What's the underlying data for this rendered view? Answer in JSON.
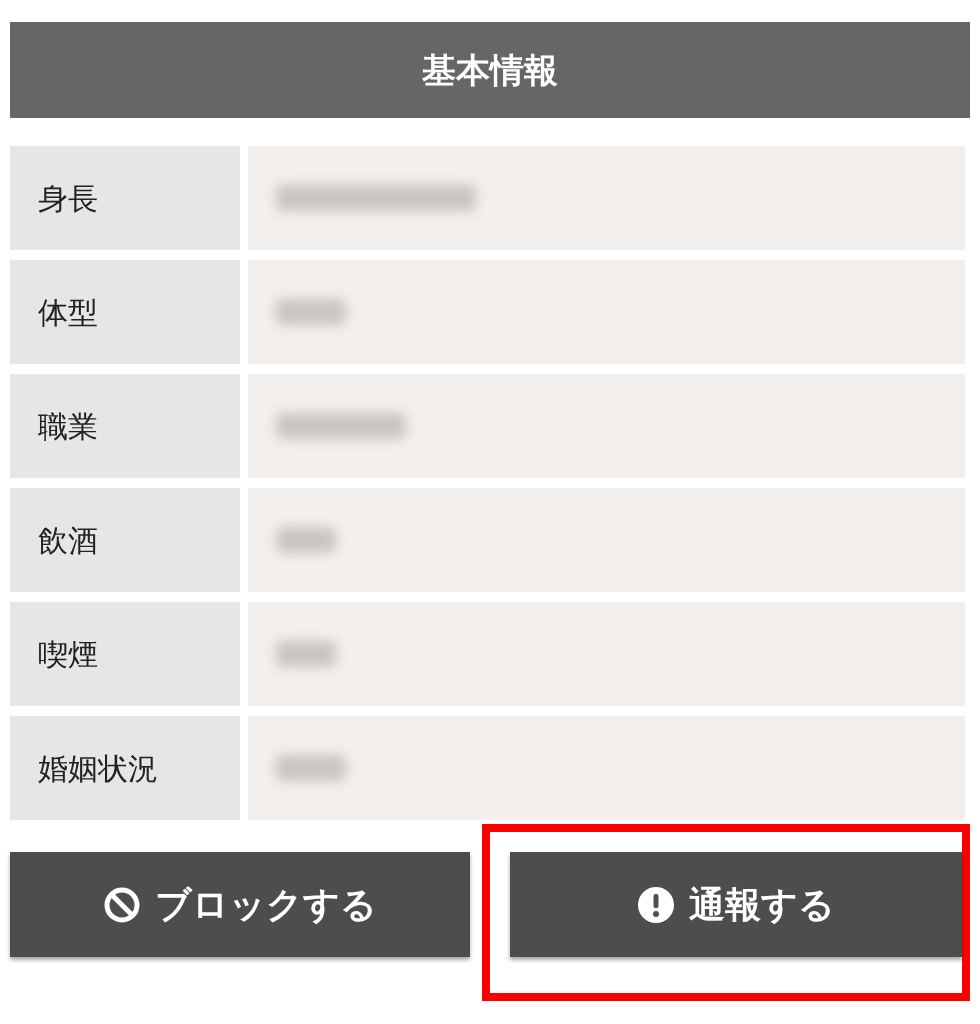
{
  "header": {
    "title": "基本情報"
  },
  "rows": [
    {
      "label": "身長",
      "value_blurred": true
    },
    {
      "label": "体型",
      "value_blurred": true
    },
    {
      "label": "職業",
      "value_blurred": true
    },
    {
      "label": "飲酒",
      "value_blurred": true
    },
    {
      "label": "喫煙",
      "value_blurred": true
    },
    {
      "label": "婚姻状況",
      "value_blurred": true
    }
  ],
  "buttons": [
    {
      "kind": "block",
      "label": "ブロックする",
      "highlighted": false
    },
    {
      "kind": "report",
      "label": "通報する",
      "highlighted": true
    }
  ]
}
